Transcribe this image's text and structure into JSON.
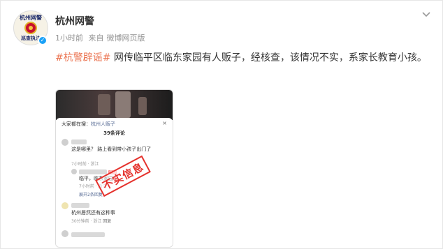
{
  "post": {
    "author": "杭州网警",
    "avatar_text_top": "杭州网警",
    "avatar_text_bottom": "巡查执法",
    "time": "1小时前",
    "source_prefix": "来自",
    "source": "微博网页版",
    "hashtag": "#杭警辟谣#",
    "body": " 网传临平区临东家园有人贩子，经核查，该情况不实，系家长教育小孩。"
  },
  "screenshot": {
    "header_prefix": "大家都在搜：",
    "header_query": "杭州人贩子",
    "close": "×",
    "comment_count": "39条评论",
    "stamp": "不实信息",
    "comments": [
      {
        "text": "这是哪里？ 路上看到带小孩子出门了",
        "meta": "7小时前 · 浙江"
      },
      {
        "text": "临平，临东家园",
        "meta": "7小时前 · 浙江"
      },
      {
        "text": "展开2条回复",
        "meta": ""
      },
      {
        "text": "杭州居然还有这种事",
        "meta": "30分钟前 · 浙江"
      }
    ],
    "reply_label": "回复",
    "author_badge": "作者"
  },
  "colors": {
    "hashtag": "#eb7350",
    "link": "#576b95",
    "stamp": "#e5322d",
    "verify": "#1aa1f7"
  }
}
